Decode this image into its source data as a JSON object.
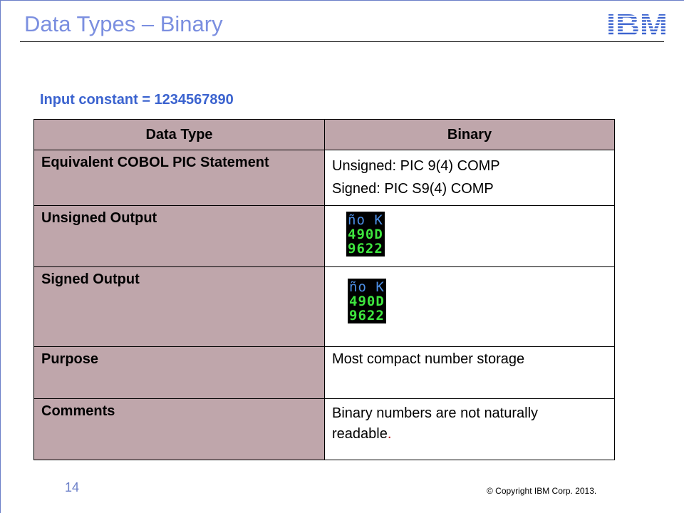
{
  "slide": {
    "title": "Data Types – Binary",
    "logo_text": "IBM",
    "input_constant": "Input constant = 1234567890",
    "page_number": "14",
    "copyright": "© Copyright  IBM Corp.  2013."
  },
  "table": {
    "headers": [
      "Data Type",
      "Binary"
    ],
    "rows": [
      {
        "label": "Equivalent COBOL PIC Statement",
        "lines": [
          "Unsigned: PIC 9(4) COMP",
          "Signed: PIC S9(4) COMP"
        ]
      },
      {
        "label": "Unsigned Output",
        "dump": [
          "ño K",
          "490D",
          "9622"
        ]
      },
      {
        "label": "Signed Output",
        "dump": [
          "ño K",
          "490D",
          "9622"
        ]
      },
      {
        "label": "Purpose",
        "lines": [
          "Most compact number storage"
        ]
      },
      {
        "label": "Comments",
        "lines": [
          "Binary numbers are not naturally",
          "readable"
        ],
        "trailing_red": "."
      }
    ]
  },
  "colors": {
    "title": "#7b8fe0",
    "accent_blue": "#3b63cf",
    "label_cell_bg": "#bfa6ab",
    "logo_blue": "#3b63cf",
    "dump_row1": "#4d8fe6",
    "dump_rows": "#3ee63e"
  }
}
